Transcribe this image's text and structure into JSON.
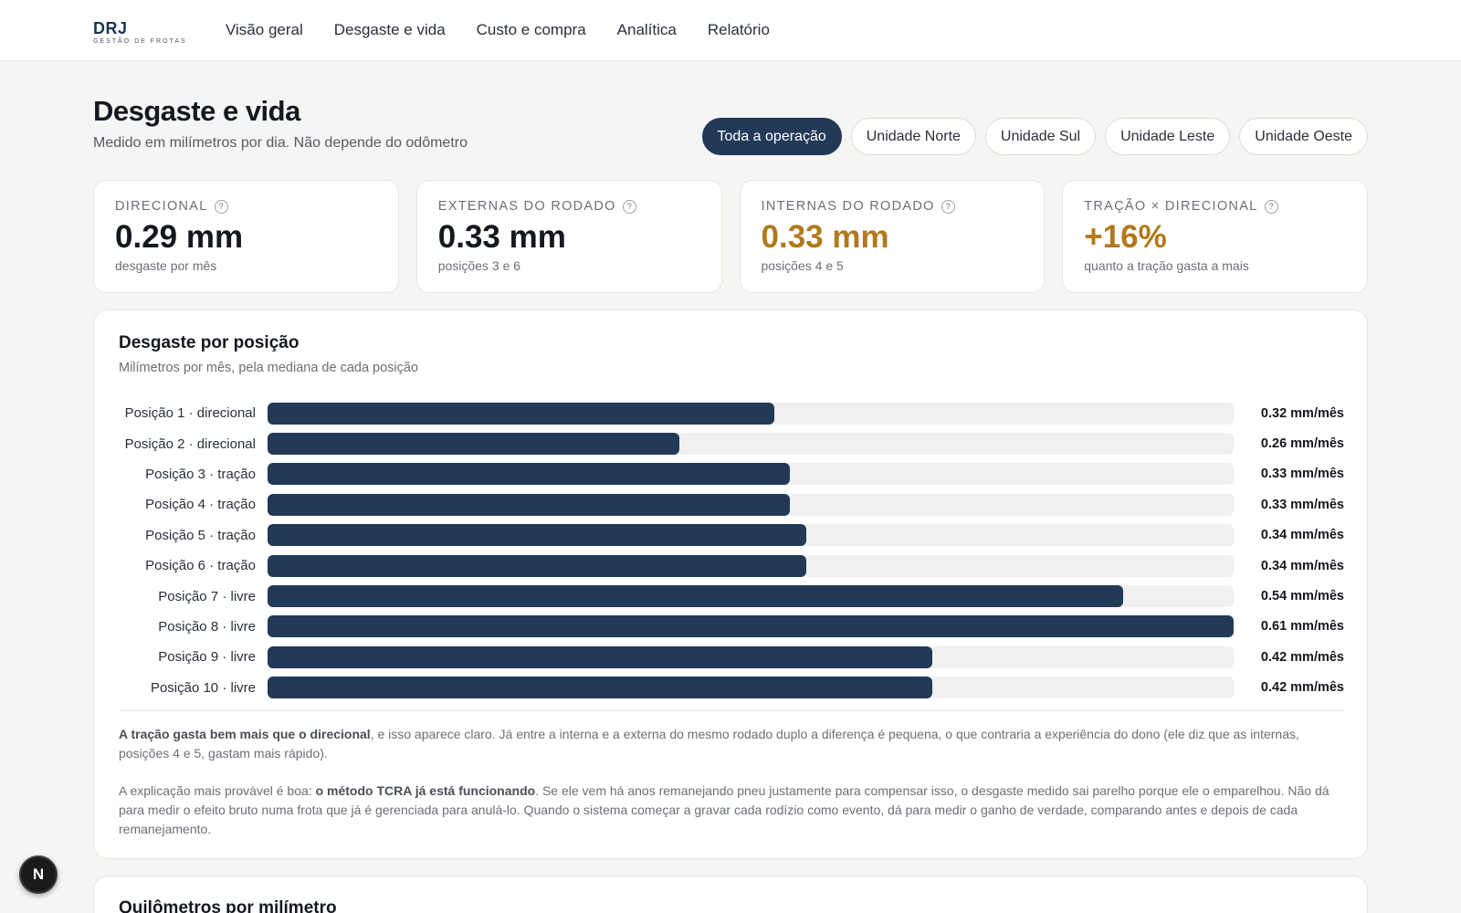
{
  "brand": {
    "name": "DRJ",
    "subtitle": "GESTÃO DE FROTAS"
  },
  "nav": [
    {
      "label": "Visão geral"
    },
    {
      "label": "Desgaste e vida"
    },
    {
      "label": "Custo e compra"
    },
    {
      "label": "Analítica"
    },
    {
      "label": "Relatório"
    }
  ],
  "header": {
    "title": "Desgaste e vida",
    "subtitle": "Medido em milímetros por dia. Não depende do odômetro"
  },
  "filters": [
    {
      "label": "Toda a operação",
      "active": true
    },
    {
      "label": "Unidade Norte",
      "active": false
    },
    {
      "label": "Unidade Sul",
      "active": false
    },
    {
      "label": "Unidade Leste",
      "active": false
    },
    {
      "label": "Unidade Oeste",
      "active": false
    }
  ],
  "kpis": [
    {
      "label": "Direcional",
      "value": "0.29 mm",
      "note": "desgaste por mês",
      "help": "?"
    },
    {
      "label": "Externas do rodado",
      "value": "0.33 mm",
      "note": "posições 3 e 6",
      "help": "?"
    },
    {
      "label": "Internas do rodado",
      "value": "0.33 mm",
      "note": "posições 4 e 5",
      "help": "?"
    },
    {
      "label": "Tração × direcional",
      "value": "+16%",
      "note": "quanto a tração gasta a mais",
      "help": "?"
    }
  ],
  "colors": {
    "bar": "#223a57",
    "track": "#f0f0ee",
    "highlight": "#b07a1c"
  },
  "panel": {
    "title": "Desgaste por posição",
    "subtitle": "Milímetros por mês, pela mediana de cada posição",
    "para1_bold": "A tração gasta bem mais que o direcional",
    "para1_rest": ", e isso aparece claro. Já entre a interna e a externa do mesmo rodado duplo a diferença é pequena, o que contraria a experiência do dono (ele diz que as internas, posições 4 e 5, gastam mais rápido).",
    "para2_start": "A explicação mais provável é boa: ",
    "para2_bold": "o método TCRA já está funcionando",
    "para2_rest": ". Se ele vem há anos remanejando pneu justamente para compensar isso, o desgaste medido sai parelho porque ele o emparelhou. Não dá para medir o efeito bruto numa frota que já é gerenciada para anulá-lo. Quando o sistema começar a gravar cada rodízio como evento, dá para medir o ganho de verdade, comparando antes e depois de cada remanejamento."
  },
  "chart_data": {
    "type": "bar",
    "orientation": "horizontal",
    "categories": [
      "Posição 1 · direcional",
      "Posição 2 · direcional",
      "Posição 3 · tração",
      "Posição 4 · tração",
      "Posição 5 · tração",
      "Posição 6 · tração",
      "Posição 7 · livre",
      "Posição 8 · livre",
      "Posição 9 · livre",
      "Posição 10 · livre"
    ],
    "values": [
      0.32,
      0.26,
      0.33,
      0.33,
      0.34,
      0.34,
      0.54,
      0.61,
      0.42,
      0.42
    ],
    "value_labels": [
      "0.32 mm/mês",
      "0.26 mm/mês",
      "0.33 mm/mês",
      "0.33 mm/mês",
      "0.34 mm/mês",
      "0.34 mm/mês",
      "0.54 mm/mês",
      "0.61 mm/mês",
      "0.42 mm/mês",
      "0.42 mm/mês"
    ],
    "xlim": [
      0,
      0.61
    ],
    "title": "Desgaste por posição",
    "subtitle": "Milímetros por mês, pela mediana de cada posição"
  },
  "next_panel": {
    "title": "Quilômetros por milímetro"
  },
  "fab": {
    "label": "N"
  }
}
